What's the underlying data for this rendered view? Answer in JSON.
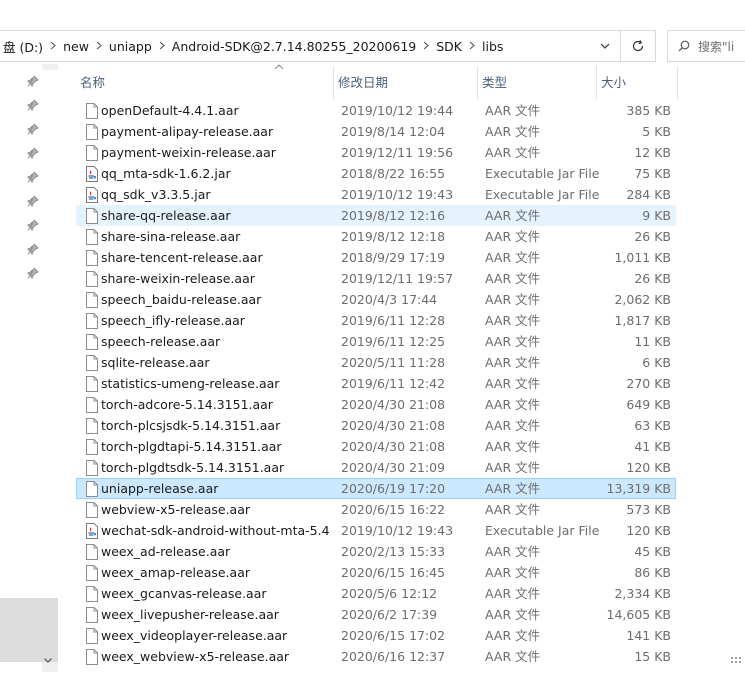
{
  "address": {
    "crumbs": [
      "盘 (D:)",
      "new",
      "uniapp",
      "Android-SDK@2.7.14.80255_20200619",
      "SDK",
      "libs"
    ],
    "search_placeholder": "搜索\"li"
  },
  "columns": {
    "name": "名称",
    "date": "修改日期",
    "type": "类型",
    "size": "大小"
  },
  "files": [
    {
      "name": "openDefault-4.4.1.aar",
      "date": "2019/10/12 19:44",
      "type": "AAR 文件",
      "size": "385 KB",
      "icon": "file-icon"
    },
    {
      "name": "payment-alipay-release.aar",
      "date": "2019/8/14 12:04",
      "type": "AAR 文件",
      "size": "5 KB",
      "icon": "file-icon"
    },
    {
      "name": "payment-weixin-release.aar",
      "date": "2019/12/11 19:56",
      "type": "AAR 文件",
      "size": "12 KB",
      "icon": "file-icon"
    },
    {
      "name": "qq_mta-sdk-1.6.2.jar",
      "date": "2018/8/22 16:55",
      "type": "Executable Jar File",
      "size": "75 KB",
      "icon": "jar-icon"
    },
    {
      "name": "qq_sdk_v3.3.5.jar",
      "date": "2019/10/12 19:43",
      "type": "Executable Jar File",
      "size": "284 KB",
      "icon": "jar-icon"
    },
    {
      "name": "share-qq-release.aar",
      "date": "2019/8/12 12:16",
      "type": "AAR 文件",
      "size": "9 KB",
      "icon": "file-icon"
    },
    {
      "name": "share-sina-release.aar",
      "date": "2019/8/12 12:18",
      "type": "AAR 文件",
      "size": "26 KB",
      "icon": "file-icon"
    },
    {
      "name": "share-tencent-release.aar",
      "date": "2018/9/29 17:19",
      "type": "AAR 文件",
      "size": "1,011 KB",
      "icon": "file-icon"
    },
    {
      "name": "share-weixin-release.aar",
      "date": "2019/12/11 19:57",
      "type": "AAR 文件",
      "size": "26 KB",
      "icon": "file-icon"
    },
    {
      "name": "speech_baidu-release.aar",
      "date": "2020/4/3 17:44",
      "type": "AAR 文件",
      "size": "2,062 KB",
      "icon": "file-icon"
    },
    {
      "name": "speech_ifly-release.aar",
      "date": "2019/6/11 12:28",
      "type": "AAR 文件",
      "size": "1,817 KB",
      "icon": "file-icon"
    },
    {
      "name": "speech-release.aar",
      "date": "2019/6/11 12:25",
      "type": "AAR 文件",
      "size": "11 KB",
      "icon": "file-icon"
    },
    {
      "name": "sqlite-release.aar",
      "date": "2020/5/11 11:28",
      "type": "AAR 文件",
      "size": "6 KB",
      "icon": "file-icon"
    },
    {
      "name": "statistics-umeng-release.aar",
      "date": "2019/6/11 12:42",
      "type": "AAR 文件",
      "size": "270 KB",
      "icon": "file-icon"
    },
    {
      "name": "torch-adcore-5.14.3151.aar",
      "date": "2020/4/30 21:08",
      "type": "AAR 文件",
      "size": "649 KB",
      "icon": "file-icon"
    },
    {
      "name": "torch-plcsjsdk-5.14.3151.aar",
      "date": "2020/4/30 21:08",
      "type": "AAR 文件",
      "size": "63 KB",
      "icon": "file-icon"
    },
    {
      "name": "torch-plgdtapi-5.14.3151.aar",
      "date": "2020/4/30 21:08",
      "type": "AAR 文件",
      "size": "41 KB",
      "icon": "file-icon"
    },
    {
      "name": "torch-plgdtsdk-5.14.3151.aar",
      "date": "2020/4/30 21:09",
      "type": "AAR 文件",
      "size": "120 KB",
      "icon": "file-icon"
    },
    {
      "name": "uniapp-release.aar",
      "date": "2020/6/19 17:20",
      "type": "AAR 文件",
      "size": "13,319 KB",
      "icon": "file-icon"
    },
    {
      "name": "webview-x5-release.aar",
      "date": "2020/6/15 16:22",
      "type": "AAR 文件",
      "size": "573 KB",
      "icon": "file-icon"
    },
    {
      "name": "wechat-sdk-android-without-mta-5.4....",
      "date": "2019/10/12 19:43",
      "type": "Executable Jar File",
      "size": "120 KB",
      "icon": "jar-icon"
    },
    {
      "name": "weex_ad-release.aar",
      "date": "2020/2/13 15:33",
      "type": "AAR 文件",
      "size": "45 KB",
      "icon": "file-icon"
    },
    {
      "name": "weex_amap-release.aar",
      "date": "2020/6/15 16:45",
      "type": "AAR 文件",
      "size": "86 KB",
      "icon": "file-icon"
    },
    {
      "name": "weex_gcanvas-release.aar",
      "date": "2020/5/6 12:12",
      "type": "AAR 文件",
      "size": "2,334 KB",
      "icon": "file-icon"
    },
    {
      "name": "weex_livepusher-release.aar",
      "date": "2020/6/2 17:39",
      "type": "AAR 文件",
      "size": "14,605 KB",
      "icon": "file-icon"
    },
    {
      "name": "weex_videoplayer-release.aar",
      "date": "2020/6/15 17:02",
      "type": "AAR 文件",
      "size": "141 KB",
      "icon": "file-icon"
    },
    {
      "name": "weex_webview-x5-release.aar",
      "date": "2020/6/16 12:37",
      "type": "AAR 文件",
      "size": "15 KB",
      "icon": "file-icon"
    }
  ],
  "hover_index": 5,
  "selected_index": 18,
  "colors": {
    "selected_bg": "#cce8ff",
    "selected_border": "#99d1ff",
    "hover_bg": "#e5f3ff",
    "header_text": "#4c607a"
  }
}
